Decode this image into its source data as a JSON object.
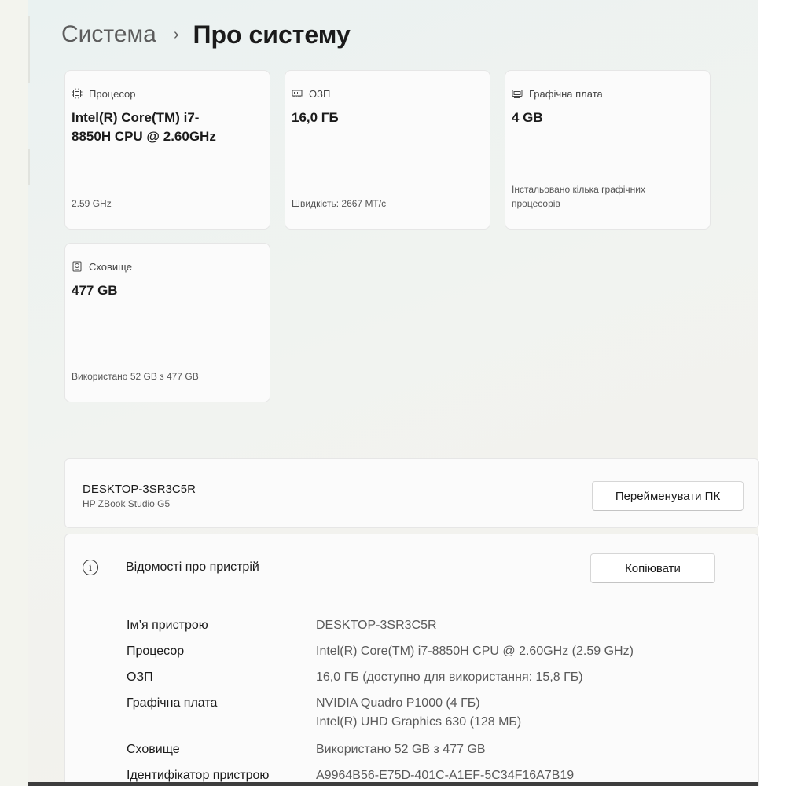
{
  "breadcrumb": {
    "parent": "Система",
    "separator": "›",
    "current": "Про систему"
  },
  "cards": {
    "cpu": {
      "label": "Процесор",
      "value": "Intel(R) Core(TM) i7-8850H CPU @ 2.60GHz",
      "sub": "2.59 GHz",
      "icon": "processor-icon"
    },
    "ram": {
      "label": "ОЗП",
      "value": "16,0 ГБ",
      "sub": "Швидкість: 2667 МТ/с",
      "icon": "memory-icon"
    },
    "gpu": {
      "label": "Графічна плата",
      "value": "4 GB",
      "sub": "Інстальовано кілька графічних процесорів",
      "icon": "display-adapter-icon"
    },
    "storage": {
      "label": "Сховище",
      "value": "477 GB",
      "sub": "Використано 52 GB з 477 GB",
      "icon": "storage-icon"
    }
  },
  "pc": {
    "name": "DESKTOP-3SR3C5R",
    "model": "HP ZBook Studio G5",
    "rename_label": "Перейменувати ПК"
  },
  "device_info": {
    "title": "Відомості про пристрій",
    "copy_label": "Копіювати",
    "info_glyph": "i",
    "rows": [
      {
        "label": "Ім’я пристрою",
        "value": "DESKTOP-3SR3C5R"
      },
      {
        "label": "Процесор",
        "value": "Intel(R) Core(TM) i7-8850H CPU @ 2.60GHz (2.59 GHz)"
      },
      {
        "label": "ОЗП",
        "value": "16,0 ГБ (доступно для використання: 15,8 ГБ)"
      },
      {
        "label": "Графічна плата",
        "value": "NVIDIA Quadro P1000 (4 ГБ)",
        "value2": "Intel(R) UHD Graphics 630 (128 МБ)"
      },
      {
        "label": "Сховище",
        "value": "Використано 52 GB з 477 GB"
      },
      {
        "label": "Ідентифікатор пристрою",
        "value": "A9964B56-E75D-401C-A1EF-5C34F16A7B19"
      }
    ]
  }
}
